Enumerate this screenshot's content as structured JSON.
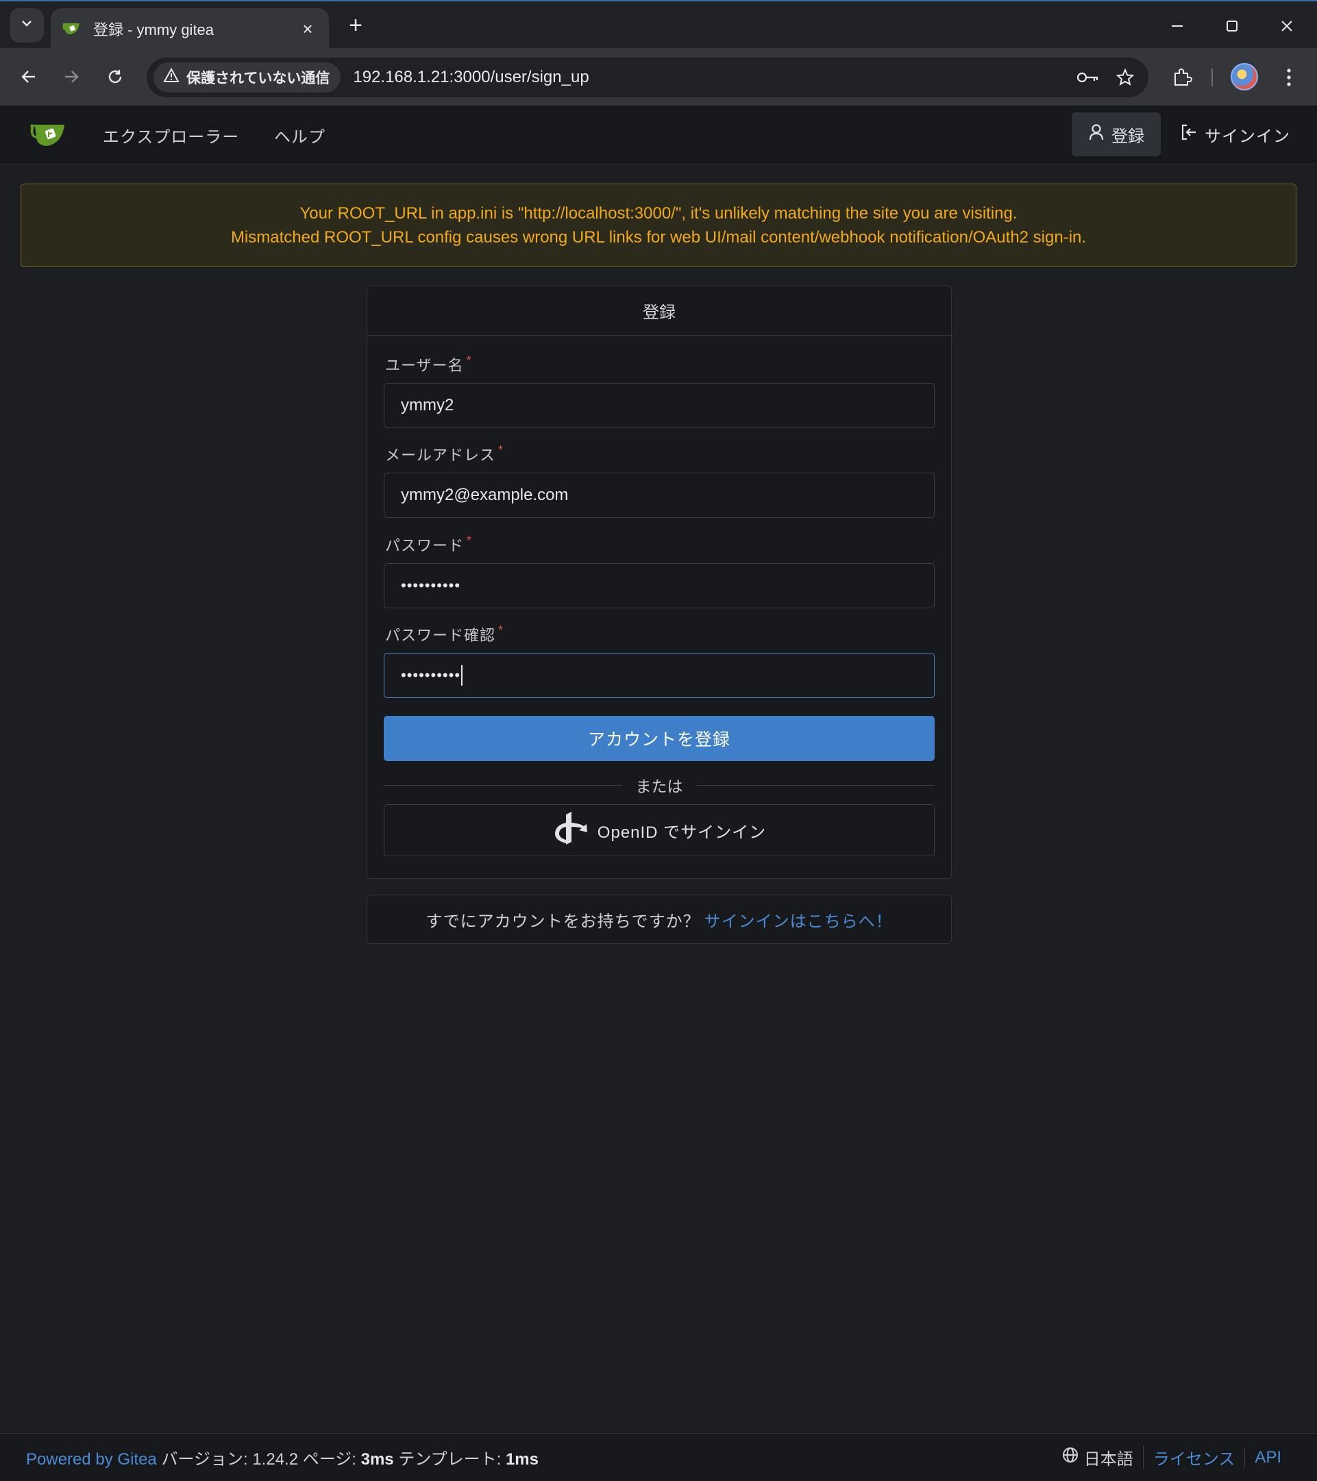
{
  "browser": {
    "tab_title": "登録 - ymmy gitea",
    "security_label": "保護されていない通信",
    "url": "192.168.1.21:3000/user/sign_up"
  },
  "navbar": {
    "explore": "エクスプローラー",
    "help": "ヘルプ",
    "register": "登録",
    "sign_in": "サインイン"
  },
  "warning": {
    "line1": "Your ROOT_URL in app.ini is \"http://localhost:3000/\", it's unlikely matching the site you are visiting.",
    "line2": "Mismatched ROOT_URL config causes wrong URL links for web UI/mail content/webhook notification/OAuth2 sign-in."
  },
  "form": {
    "title": "登録",
    "username_label": "ユーザー名",
    "username_value": "ymmy2",
    "email_label": "メールアドレス",
    "email_value": "ymmy2@example.com",
    "password_label": "パスワード",
    "password_value": "••••••••••",
    "confirm_label": "パスワード確認",
    "confirm_value": "••••••••••",
    "required_mark": "*",
    "submit": "アカウントを登録",
    "or": "または",
    "openid": "OpenID でサインイン"
  },
  "signin_prompt": {
    "text": "すでにアカウントをお持ちですか？",
    "link": "サインインはこちらへ！"
  },
  "footer": {
    "powered_by": "Powered by Gitea",
    "version_label": "バージョン:",
    "version": "1.24.2",
    "page_label": "ページ:",
    "page_time": "3ms",
    "template_label": "テンプレート:",
    "template_time": "1ms",
    "language": "日本語",
    "license": "ライセンス",
    "api": "API"
  },
  "colors": {
    "accent": "#3f7fc9",
    "link": "#4b8ad4",
    "warning_text": "#f2a91b",
    "required": "#e0524f",
    "gitea_green": "#609926"
  }
}
